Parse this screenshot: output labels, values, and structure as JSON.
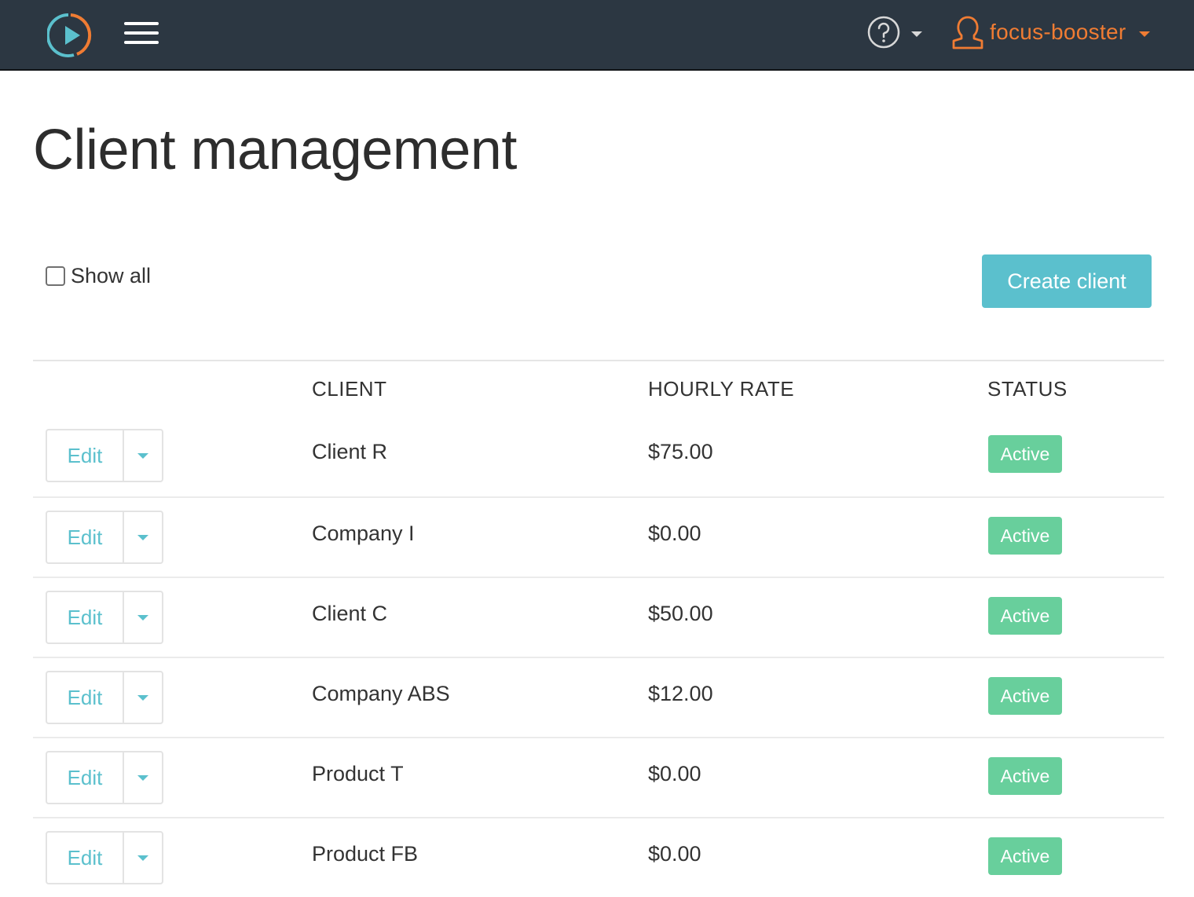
{
  "header": {
    "logo_icon": "play-circle-logo-icon",
    "menu_icon": "hamburger-menu-icon",
    "help_icon": "question-circle-icon",
    "user_icon": "user-outline-icon",
    "user_name": "focus-booster",
    "colors": {
      "bar": "#2c3742",
      "accent_orange": "#f07c33",
      "accent_teal": "#5bc0cd"
    }
  },
  "page": {
    "title": "Client management",
    "show_all_label": "Show all",
    "show_all_checked": false,
    "create_button": "Create client"
  },
  "table": {
    "columns": [
      "",
      "CLIENT",
      "HOURLY RATE",
      "STATUS"
    ],
    "edit_label": "Edit",
    "rows": [
      {
        "client": "Client R",
        "rate": "$75.00",
        "status": "Active"
      },
      {
        "client": "Company I",
        "rate": "$0.00",
        "status": "Active"
      },
      {
        "client": "Client C",
        "rate": "$50.00",
        "status": "Active"
      },
      {
        "client": "Company ABS",
        "rate": "$12.00",
        "status": "Active"
      },
      {
        "client": "Product T",
        "rate": "$0.00",
        "status": "Active"
      },
      {
        "client": "Product FB",
        "rate": "$0.00",
        "status": "Active"
      }
    ],
    "status_color": "#68cf9c"
  }
}
